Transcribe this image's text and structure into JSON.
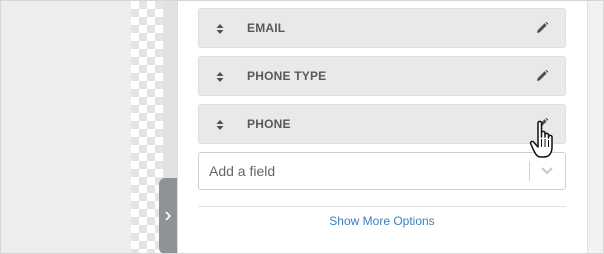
{
  "fields": [
    {
      "label": "EMAIL"
    },
    {
      "label": "PHONE TYPE"
    },
    {
      "label": "PHONE"
    }
  ],
  "add_field": {
    "placeholder": "Add a field"
  },
  "more_options_label": "Show More Options",
  "icons": {
    "drag": "sort-arrows-icon",
    "edit": "pencil-icon",
    "toggle": "chevron-right-icon",
    "dropdown": "chevron-down-icon",
    "cursor": "hand-pointer-icon"
  },
  "colors": {
    "link": "#3a7fc1",
    "row_bg": "#e9e9e9",
    "label": "#555a5f",
    "tab": "#8f9296"
  }
}
